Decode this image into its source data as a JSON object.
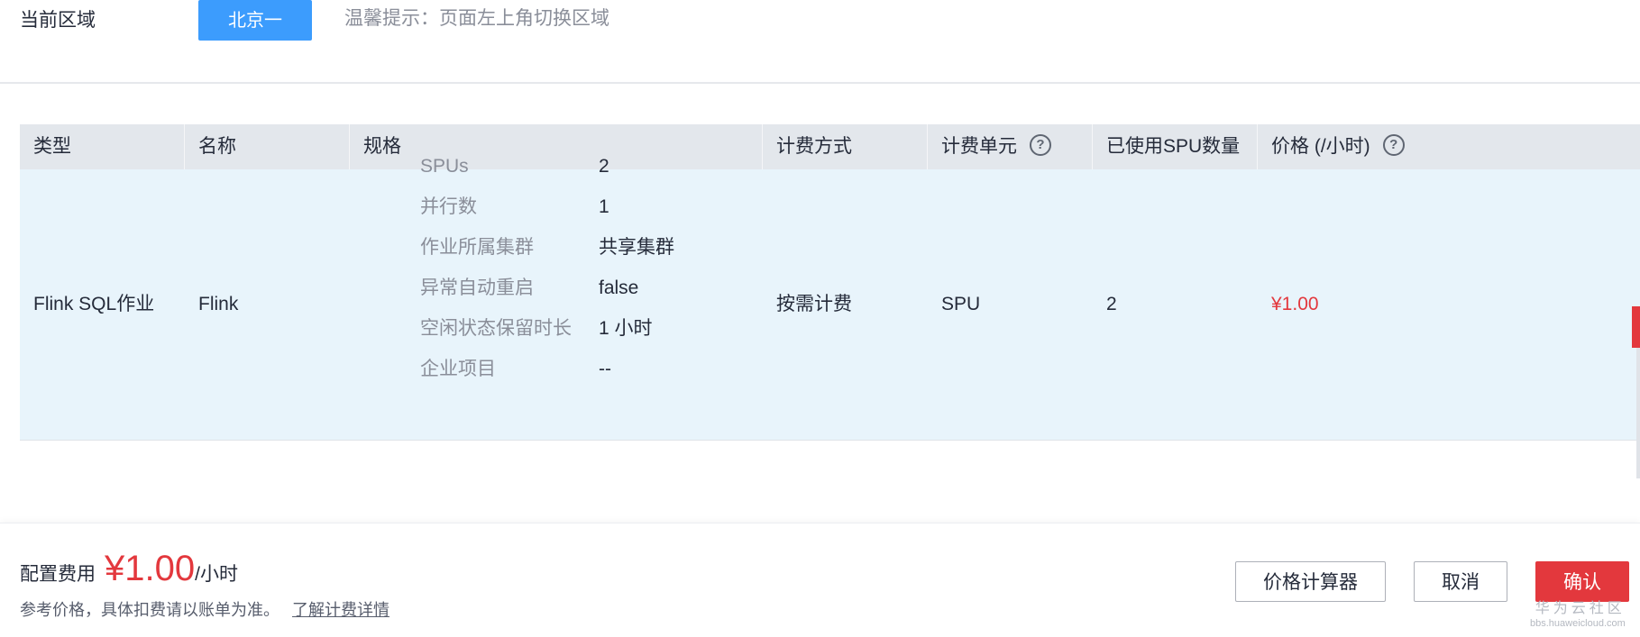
{
  "region": {
    "label": "当前区域",
    "selected": "北京一",
    "tip": "温馨提示：页面左上角切换区域"
  },
  "table": {
    "headers": {
      "type": "类型",
      "name": "名称",
      "spec": "规格",
      "billing_mode": "计费方式",
      "billing_unit": "计费单元",
      "spu_used": "已使用SPU数量",
      "price": "价格 (/小时)"
    },
    "row": {
      "type": "Flink SQL作业",
      "name": "Flink",
      "specs": [
        {
          "key": "SPUs",
          "value": "2"
        },
        {
          "key": "并行数",
          "value": "1"
        },
        {
          "key": "作业所属集群",
          "value": "共享集群"
        },
        {
          "key": "异常自动重启",
          "value": "false"
        },
        {
          "key": "空闲状态保留时长",
          "value": "1 小时"
        },
        {
          "key": "企业项目",
          "value": "--"
        }
      ],
      "billing_mode": "按需计费",
      "billing_unit": "SPU",
      "spu_used": "2",
      "price": "¥1.00"
    }
  },
  "footer": {
    "fee_label": "配置费用",
    "fee_amount": "¥1.00",
    "fee_unit": "/小时",
    "note": "参考价格，具体扣费请以账单为准。",
    "link": "了解计费详情",
    "buttons": {
      "calculator": "价格计算器",
      "cancel": "取消",
      "confirm": "确认"
    },
    "watermark_cn": "华为云社区",
    "watermark_en": "bbs.huaweicloud.com"
  },
  "colors": {
    "primary_blue": "#3c9cfd",
    "accent_red": "#e3383d",
    "row_highlight": "#e8f4fb",
    "header_bg": "#e3e7ec"
  },
  "icons": [
    "help-circle-icon"
  ]
}
